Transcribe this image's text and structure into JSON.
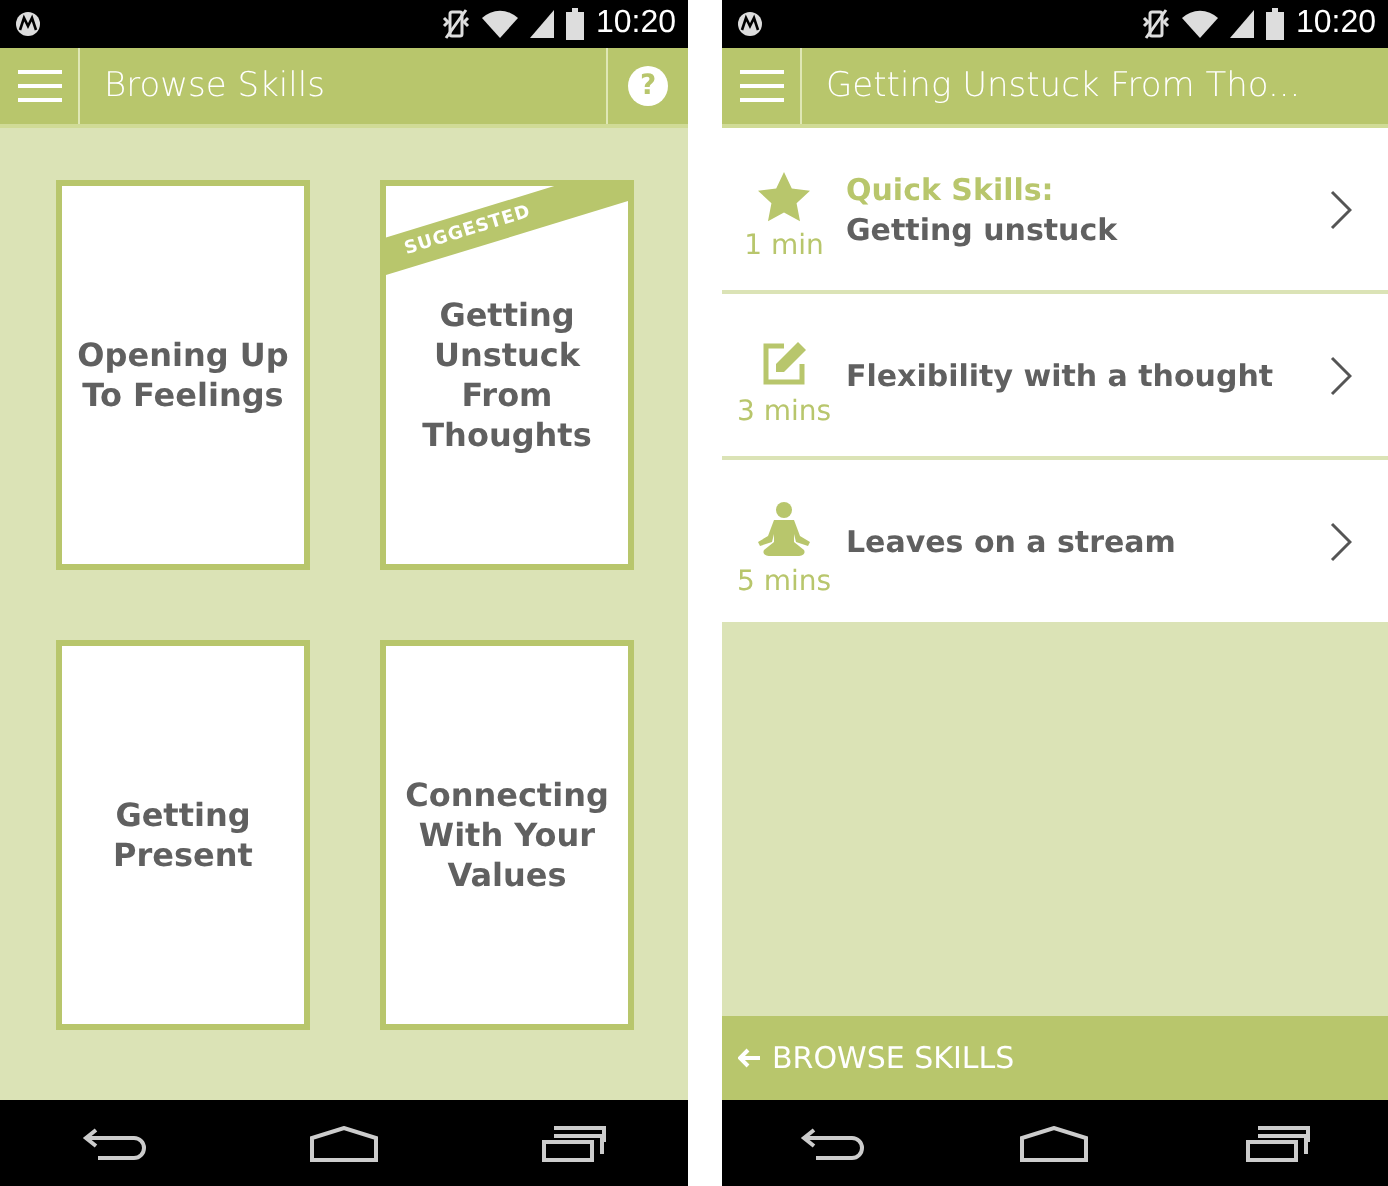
{
  "browse_screen": {
    "status_bar": {
      "time": "10:20"
    },
    "app_bar": {
      "title": "Browse Skills",
      "help": "?"
    },
    "cards": [
      {
        "title": "Opening Up To Feelings"
      },
      {
        "title": "Getting Unstuck From Thoughts",
        "badge": "SUGGESTED"
      },
      {
        "title": "Getting Present"
      },
      {
        "title": "Connecting With Your Values"
      }
    ]
  },
  "skill_screen": {
    "status_bar": {
      "time": "10:20"
    },
    "app_bar": {
      "title": "Getting Unstuck From Tho..."
    },
    "rows": [
      {
        "kind": "star",
        "duration": "1 min",
        "label": "Quick Skills:",
        "title": "Getting unstuck"
      },
      {
        "kind": "edit",
        "duration": "3 mins",
        "title": "Flexibility with a thought"
      },
      {
        "kind": "figure",
        "duration": "5 mins",
        "title": "Leaves on a stream"
      }
    ],
    "bottom_link": "BROWSE SKILLS"
  }
}
